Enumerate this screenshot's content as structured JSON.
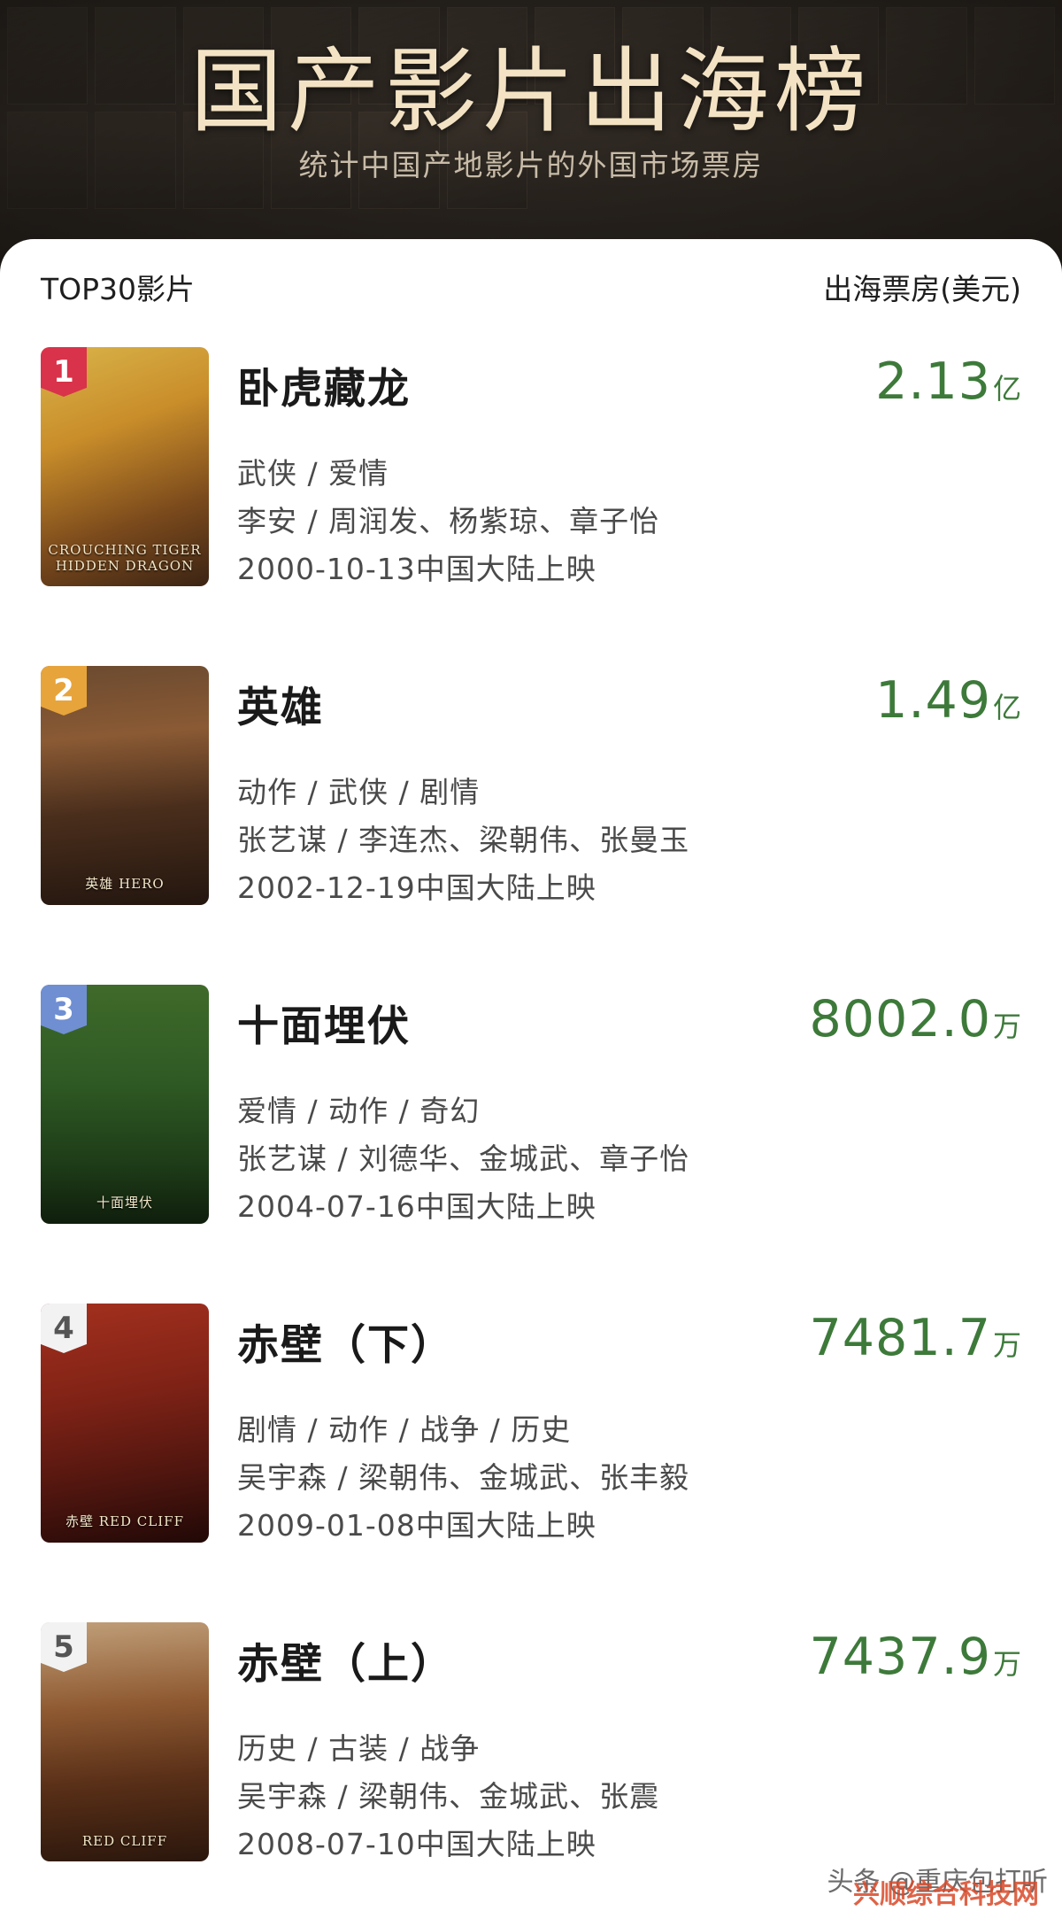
{
  "header_banner": {
    "title": "国产影片出海榜",
    "subtitle": "统计中国产地影片的外国市场票房"
  },
  "list_header": {
    "left": "TOP30影片",
    "right": "出海票房(美元)"
  },
  "colors": {
    "amount_green": "#3d7a3a",
    "rank1": "#d8334a",
    "rank2": "#e7a43b",
    "rank3": "#6f8fd2",
    "rank_other": "#f2f2f2"
  },
  "movies": [
    {
      "rank": "1",
      "title": "卧虎藏龙",
      "genres": "武侠 / 爱情",
      "crew": "李安 / 周润发、杨紫琼、章子怡",
      "release": "2000-10-13中国大陆上映",
      "amount": "2.13",
      "unit": "亿",
      "poster_caption": "CROUCHING TIGER HIDDEN DRAGON"
    },
    {
      "rank": "2",
      "title": "英雄",
      "genres": "动作 / 武侠 / 剧情",
      "crew": "张艺谋 / 李连杰、梁朝伟、张曼玉",
      "release": "2002-12-19中国大陆上映",
      "amount": "1.49",
      "unit": "亿",
      "poster_caption": "英雄 HERO"
    },
    {
      "rank": "3",
      "title": "十面埋伏",
      "genres": "爱情 / 动作 / 奇幻",
      "crew": "张艺谋 / 刘德华、金城武、章子怡",
      "release": "2004-07-16中国大陆上映",
      "amount": "8002.0",
      "unit": "万",
      "poster_caption": "十面埋伏"
    },
    {
      "rank": "4",
      "title": "赤壁（下）",
      "genres": "剧情 / 动作 / 战争 / 历史",
      "crew": "吴宇森 / 梁朝伟、金城武、张丰毅",
      "release": "2009-01-08中国大陆上映",
      "amount": "7481.7",
      "unit": "万",
      "poster_caption": "赤壁 RED CLIFF"
    },
    {
      "rank": "5",
      "title": "赤壁（上）",
      "genres": "历史 / 古装 / 战争",
      "crew": "吴宇森 / 梁朝伟、金城武、张震",
      "release": "2008-07-10中国大陆上映",
      "amount": "7437.9",
      "unit": "万",
      "poster_caption": "RED CLIFF"
    }
  ],
  "watermark": {
    "source": "头条 @重庆包打听",
    "site": "兴顺综合科技网"
  }
}
